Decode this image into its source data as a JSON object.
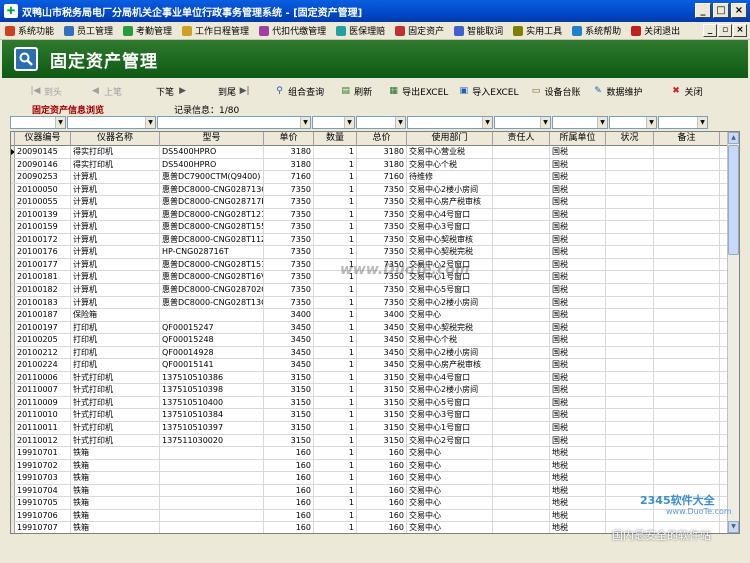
{
  "window": {
    "title": "双鸭山市税务局电厂分局机关企事业单位行政事务管理系统 - [固定资产管理]"
  },
  "menu": [
    "系统功能",
    "员工管理",
    "考勤管理",
    "工作日程管理",
    "代扣代缴管理",
    "医保理赔",
    "固定资产",
    "智能取词",
    "实用工具",
    "系统帮助",
    "关闭退出"
  ],
  "menu_icon_colors": [
    "#d04020",
    "#3070c0",
    "#2a9a40",
    "#d0a020",
    "#a040a0",
    "#20a0a0",
    "#c03030",
    "#4060d0",
    "#808000",
    "#2080d0",
    "#c02020"
  ],
  "banner": {
    "title": "固定资产管理"
  },
  "toolbar": {
    "first": "到头",
    "prev": "上笔",
    "next": "下笔",
    "last": "到尾",
    "query": "组合查询",
    "refresh": "刷新",
    "export": "导出EXCEL",
    "import": "导入EXCEL",
    "ledger": "设备台账",
    "maintain": "数据维护",
    "close": "关闭"
  },
  "info": {
    "title": "固定资产信息浏览",
    "count": "记录信息：1/80"
  },
  "columns": [
    "仪器编号",
    "仪器名称",
    "型号",
    "单价",
    "数量",
    "总价",
    "使用部门",
    "责任人",
    "所属单位",
    "状况",
    "备注"
  ],
  "rows": [
    [
      "20090145",
      "得实打印机",
      "DS5400HPRO",
      "3180",
      "1",
      "3180",
      "交易中心营业税",
      "",
      "国税",
      "",
      ""
    ],
    [
      "20090146",
      "得实打印机",
      "DS5400HPRO",
      "3180",
      "1",
      "3180",
      "交易中心个税",
      "",
      "国税",
      "",
      ""
    ],
    [
      "20090253",
      "计算机",
      "惠普DC7900CTM(Q9400)",
      "7160",
      "1",
      "7160",
      "待维修",
      "",
      "国税",
      "",
      ""
    ],
    [
      "20100050",
      "计算机",
      "惠普DC8000-CNG028713Q",
      "7350",
      "1",
      "7350",
      "交易中心2楼小房间",
      "",
      "国税",
      "",
      ""
    ],
    [
      "20100055",
      "计算机",
      "惠普DC8000-CNG028717H",
      "7350",
      "1",
      "7350",
      "交易中心房产税审核",
      "",
      "国税",
      "",
      ""
    ],
    [
      "20100139",
      "计算机",
      "惠普DC8000-CNG028T121",
      "7350",
      "1",
      "7350",
      "交易中心4号窗口",
      "",
      "国税",
      "",
      ""
    ],
    [
      "20100159",
      "计算机",
      "惠普DC8000-CNG028T155",
      "7350",
      "1",
      "7350",
      "交易中心3号窗口",
      "",
      "国税",
      "",
      ""
    ],
    [
      "20100172",
      "计算机",
      "惠普DC8000-CNG028T11Z",
      "7350",
      "1",
      "7350",
      "交易中心契税审核",
      "",
      "国税",
      "",
      ""
    ],
    [
      "20100176",
      "计算机",
      "HP-CNG028716T",
      "7350",
      "1",
      "7350",
      "交易中心契税完税",
      "",
      "国税",
      "",
      ""
    ],
    [
      "20100177",
      "计算机",
      "惠普DC8000-CNG028T151",
      "7350",
      "1",
      "7350",
      "交易中心2号窗口",
      "",
      "国税",
      "",
      ""
    ],
    [
      "20100181",
      "计算机",
      "惠普DC8000-CNG028T16V",
      "7350",
      "1",
      "7350",
      "交易中心1号窗口",
      "",
      "国税",
      "",
      ""
    ],
    [
      "20100182",
      "计算机",
      "惠普DC8000-CNG028702Q",
      "7350",
      "1",
      "7350",
      "交易中心5号窗口",
      "",
      "国税",
      "",
      ""
    ],
    [
      "20100183",
      "计算机",
      "惠普DC8000-CNG028T13G",
      "7350",
      "1",
      "7350",
      "交易中心2楼小房间",
      "",
      "国税",
      "",
      ""
    ],
    [
      "20100187",
      "保险箱",
      "",
      "3400",
      "1",
      "3400",
      "交易中心",
      "",
      "国税",
      "",
      ""
    ],
    [
      "20100197",
      "打印机",
      "QF00015247",
      "3450",
      "1",
      "3450",
      "交易中心契税完税",
      "",
      "国税",
      "",
      ""
    ],
    [
      "20100205",
      "打印机",
      "QF00015248",
      "3450",
      "1",
      "3450",
      "交易中心个税",
      "",
      "国税",
      "",
      ""
    ],
    [
      "20100212",
      "打印机",
      "QF00014928",
      "3450",
      "1",
      "3450",
      "交易中心2楼小房间",
      "",
      "国税",
      "",
      ""
    ],
    [
      "20100224",
      "打印机",
      "QF00015141",
      "3450",
      "1",
      "3450",
      "交易中心房产税审核",
      "",
      "国税",
      "",
      ""
    ],
    [
      "20110006",
      "针式打印机",
      "137510510386",
      "3150",
      "1",
      "3150",
      "交易中心4号窗口",
      "",
      "国税",
      "",
      ""
    ],
    [
      "20110007",
      "针式打印机",
      "137510510398",
      "3150",
      "1",
      "3150",
      "交易中心2楼小房间",
      "",
      "国税",
      "",
      ""
    ],
    [
      "20110009",
      "针式打印机",
      "137510510400",
      "3150",
      "1",
      "3150",
      "交易中心5号窗口",
      "",
      "国税",
      "",
      ""
    ],
    [
      "20110010",
      "针式打印机",
      "137510510384",
      "3150",
      "1",
      "3150",
      "交易中心3号窗口",
      "",
      "国税",
      "",
      ""
    ],
    [
      "20110011",
      "针式打印机",
      "137510510397",
      "3150",
      "1",
      "3150",
      "交易中心1号窗口",
      "",
      "国税",
      "",
      ""
    ],
    [
      "20110012",
      "针式打印机",
      "137511030020",
      "3150",
      "1",
      "3150",
      "交易中心2号窗口",
      "",
      "国税",
      "",
      ""
    ],
    [
      "19910701",
      "铁箱",
      "",
      "160",
      "1",
      "160",
      "交易中心",
      "",
      "地税",
      "",
      ""
    ],
    [
      "19910702",
      "铁箱",
      "",
      "160",
      "1",
      "160",
      "交易中心",
      "",
      "地税",
      "",
      ""
    ],
    [
      "19910703",
      "铁箱",
      "",
      "160",
      "1",
      "160",
      "交易中心",
      "",
      "地税",
      "",
      ""
    ],
    [
      "19910704",
      "铁箱",
      "",
      "160",
      "1",
      "160",
      "交易中心",
      "",
      "地税",
      "",
      ""
    ],
    [
      "19910705",
      "铁箱",
      "",
      "160",
      "1",
      "160",
      "交易中心",
      "",
      "地税",
      "",
      ""
    ],
    [
      "19910706",
      "铁箱",
      "",
      "160",
      "1",
      "160",
      "交易中心",
      "",
      "地税",
      "",
      ""
    ],
    [
      "19910707",
      "铁箱",
      "",
      "160",
      "1",
      "160",
      "交易中心",
      "",
      "地税",
      "",
      ""
    ]
  ],
  "watermarks": {
    "center": "www.DuoTe.com",
    "logo": "2345软件大全",
    "logo_url": "www.DuoTe.com",
    "bottom": "国内最安全的软件站"
  }
}
